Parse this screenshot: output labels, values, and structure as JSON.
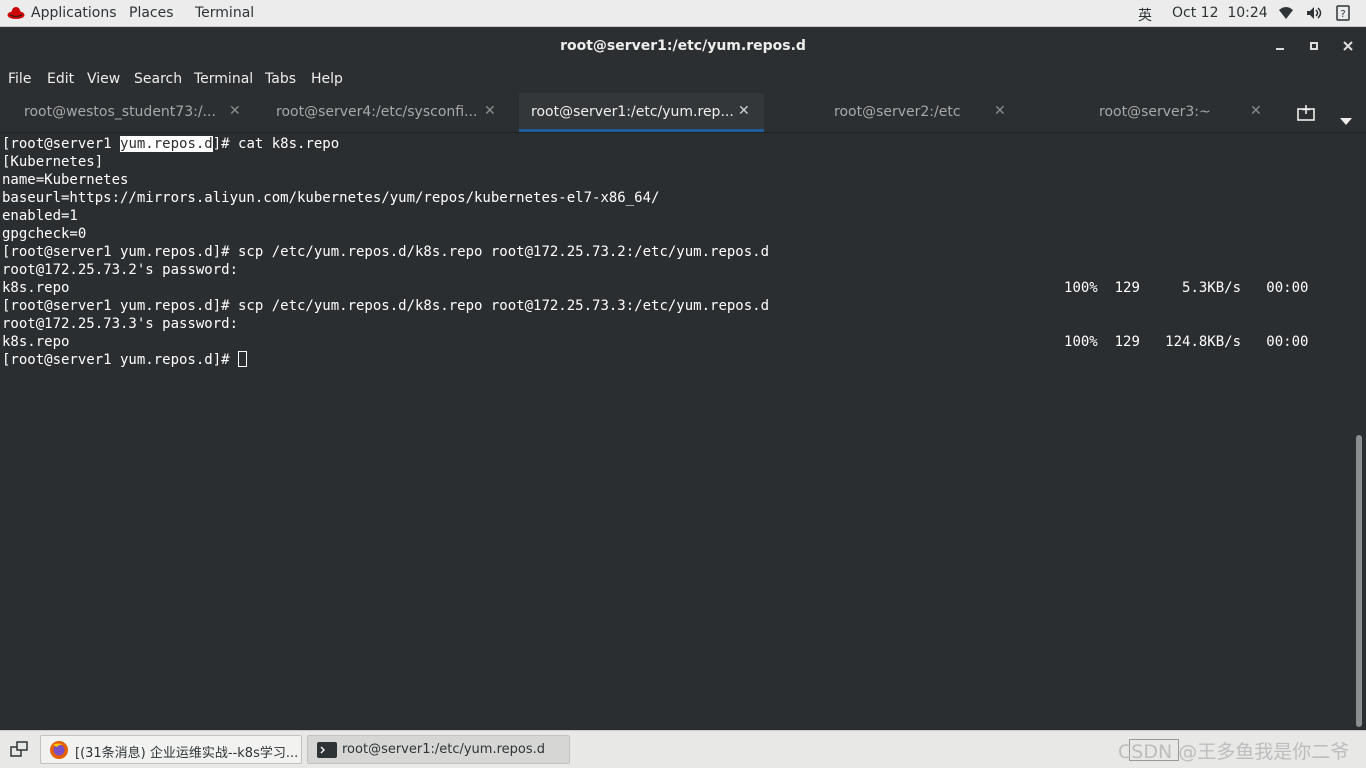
{
  "topbar": {
    "applications": "Applications",
    "places": "Places",
    "terminal": "Terminal",
    "input_method": "英",
    "clock": "Oct 12  10:24"
  },
  "window": {
    "title": "root@server1:/etc/yum.repos.d"
  },
  "menu": [
    "File",
    "Edit",
    "View",
    "Search",
    "Terminal",
    "Tabs",
    "Help"
  ],
  "tabs": [
    {
      "label": "root@westos_student73:/..."
    },
    {
      "label": "root@server4:/etc/sysconfi..."
    },
    {
      "label": "root@server1:/etc/yum.rep..."
    },
    {
      "label": "root@server2:/etc"
    },
    {
      "label": "root@server3:~"
    }
  ],
  "terminal": {
    "line0_pre": "[root@server1 ",
    "line0_sel": "yum.repos.d",
    "line0_post": "]# cat k8s.repo",
    "line1": "[Kubernetes]",
    "line2": "name=Kubernetes",
    "line3": "baseurl=https://mirrors.aliyun.com/kubernetes/yum/repos/kubernetes-el7-x86_64/",
    "line4": "enabled=1",
    "line5": "gpgcheck=0",
    "line6": "[root@server1 yum.repos.d]# scp /etc/yum.repos.d/k8s.repo root@172.25.73.2:/etc/yum.repos.d",
    "line7": "root@172.25.73.2's password: ",
    "line8": "k8s.repo                                                                                                                      100%  129     5.3KB/s   00:00    ",
    "line9": "[root@server1 yum.repos.d]# scp /etc/yum.repos.d/k8s.repo root@172.25.73.3:/etc/yum.repos.d",
    "line10": "root@172.25.73.3's password: ",
    "line11": "k8s.repo                                                                                                                      100%  129   124.8KB/s   00:00    ",
    "line12": "[root@server1 yum.repos.d]# "
  },
  "taskbar": {
    "firefox_task": "[(31条消息) 企业运维实战--k8s学习...",
    "terminal_task": "root@server1:/etc/yum.repos.d"
  },
  "watermark": "CSDN @王多鱼我是你二爷",
  "colors": {
    "accent": "#215d9c",
    "terminal_bg": "#2b2e30",
    "redhat": "#cc0000"
  }
}
